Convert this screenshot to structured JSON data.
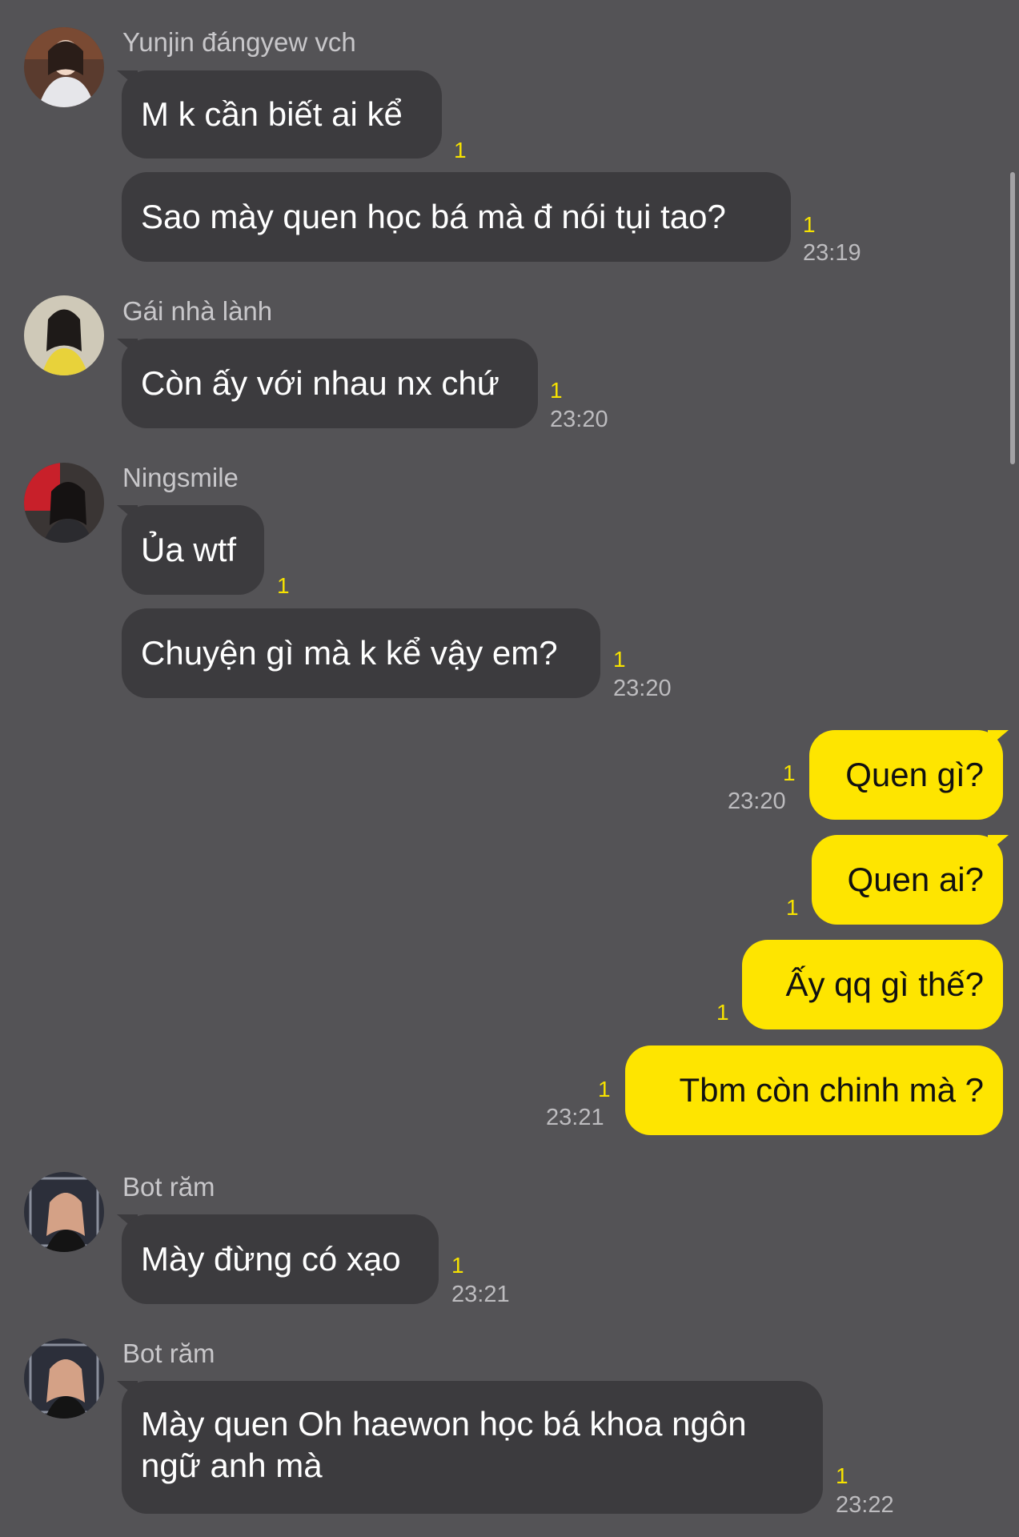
{
  "colors": {
    "background": "#545356",
    "incoming_bubble": "#3c3b3e",
    "outgoing_bubble": "#fee500",
    "unread_count": "#f6e200"
  },
  "messages": {
    "g1": {
      "sender": "Yunjin đángyew vch",
      "avatar_icon": "profile-photo",
      "m1": {
        "text": "M k cần biết ai kể",
        "unread": "1"
      },
      "m2": {
        "text": "Sao mày quen học bá mà đ nói tụi tao?",
        "unread": "1",
        "time": "23:19"
      }
    },
    "g2": {
      "sender": "Gái nhà lành",
      "avatar_icon": "profile-photo",
      "m1": {
        "text": "Còn ấy với nhau nx chứ",
        "unread": "1",
        "time": "23:20"
      }
    },
    "g3": {
      "sender": "Ningsmile",
      "avatar_icon": "profile-photo",
      "m1": {
        "text": "Ủa wtf",
        "unread": "1"
      },
      "m2": {
        "text": "Chuyện gì mà k kể vậy em?",
        "unread": "1",
        "time": "23:20"
      }
    },
    "me": {
      "m1": {
        "text": "Quen gì?",
        "unread": "1",
        "time": "23:20"
      },
      "m2": {
        "text": "Quen ai?",
        "unread": "1"
      },
      "m3": {
        "text": "Ấy qq gì thế?",
        "unread": "1"
      },
      "m4": {
        "text": "Tbm còn chinh mà ?",
        "unread": "1",
        "time": "23:21"
      }
    },
    "g4": {
      "sender": "Bot răm",
      "avatar_icon": "profile-photo",
      "m1": {
        "text": "Mày đừng có xạo",
        "unread": "1",
        "time": "23:21"
      }
    },
    "g5": {
      "sender": "Bot răm",
      "avatar_icon": "profile-photo",
      "m1": {
        "text": "Mày quen Oh haewon học bá khoa ngôn ngữ anh mà",
        "unread": "1",
        "time": "23:22"
      }
    }
  }
}
